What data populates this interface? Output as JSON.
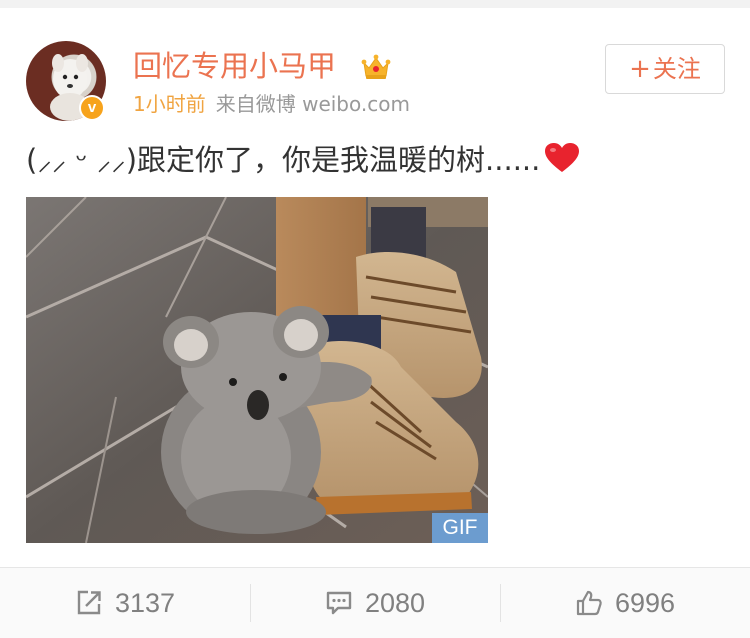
{
  "post": {
    "username": "回忆专用小马甲",
    "verified_badge": "v",
    "time": "1小时前",
    "source": "来自微博 weibo.com",
    "follow_label": "关注",
    "follow_plus": "+",
    "text": "(⁻̮ ⁻̮)跟定你了，你是我温暖的树......",
    "text_display": "(⸝⸝ ᵕ ⸝⸝)跟定你了，你是我温暖的树......",
    "media_badge": "GIF"
  },
  "actions": {
    "repost_count": "3137",
    "comment_count": "2080",
    "like_count": "6996"
  },
  "icons": {
    "crown": "crown-icon",
    "heart": "heart-icon",
    "repost": "share-icon",
    "comment": "comment-icon",
    "like": "thumbs-up-icon"
  },
  "colors": {
    "username": "#eb7350",
    "time": "#f0a441",
    "meta": "#999999",
    "gif_badge": "#6c9ccf",
    "heart": "#e8232e",
    "verified": "#f7a31c"
  }
}
